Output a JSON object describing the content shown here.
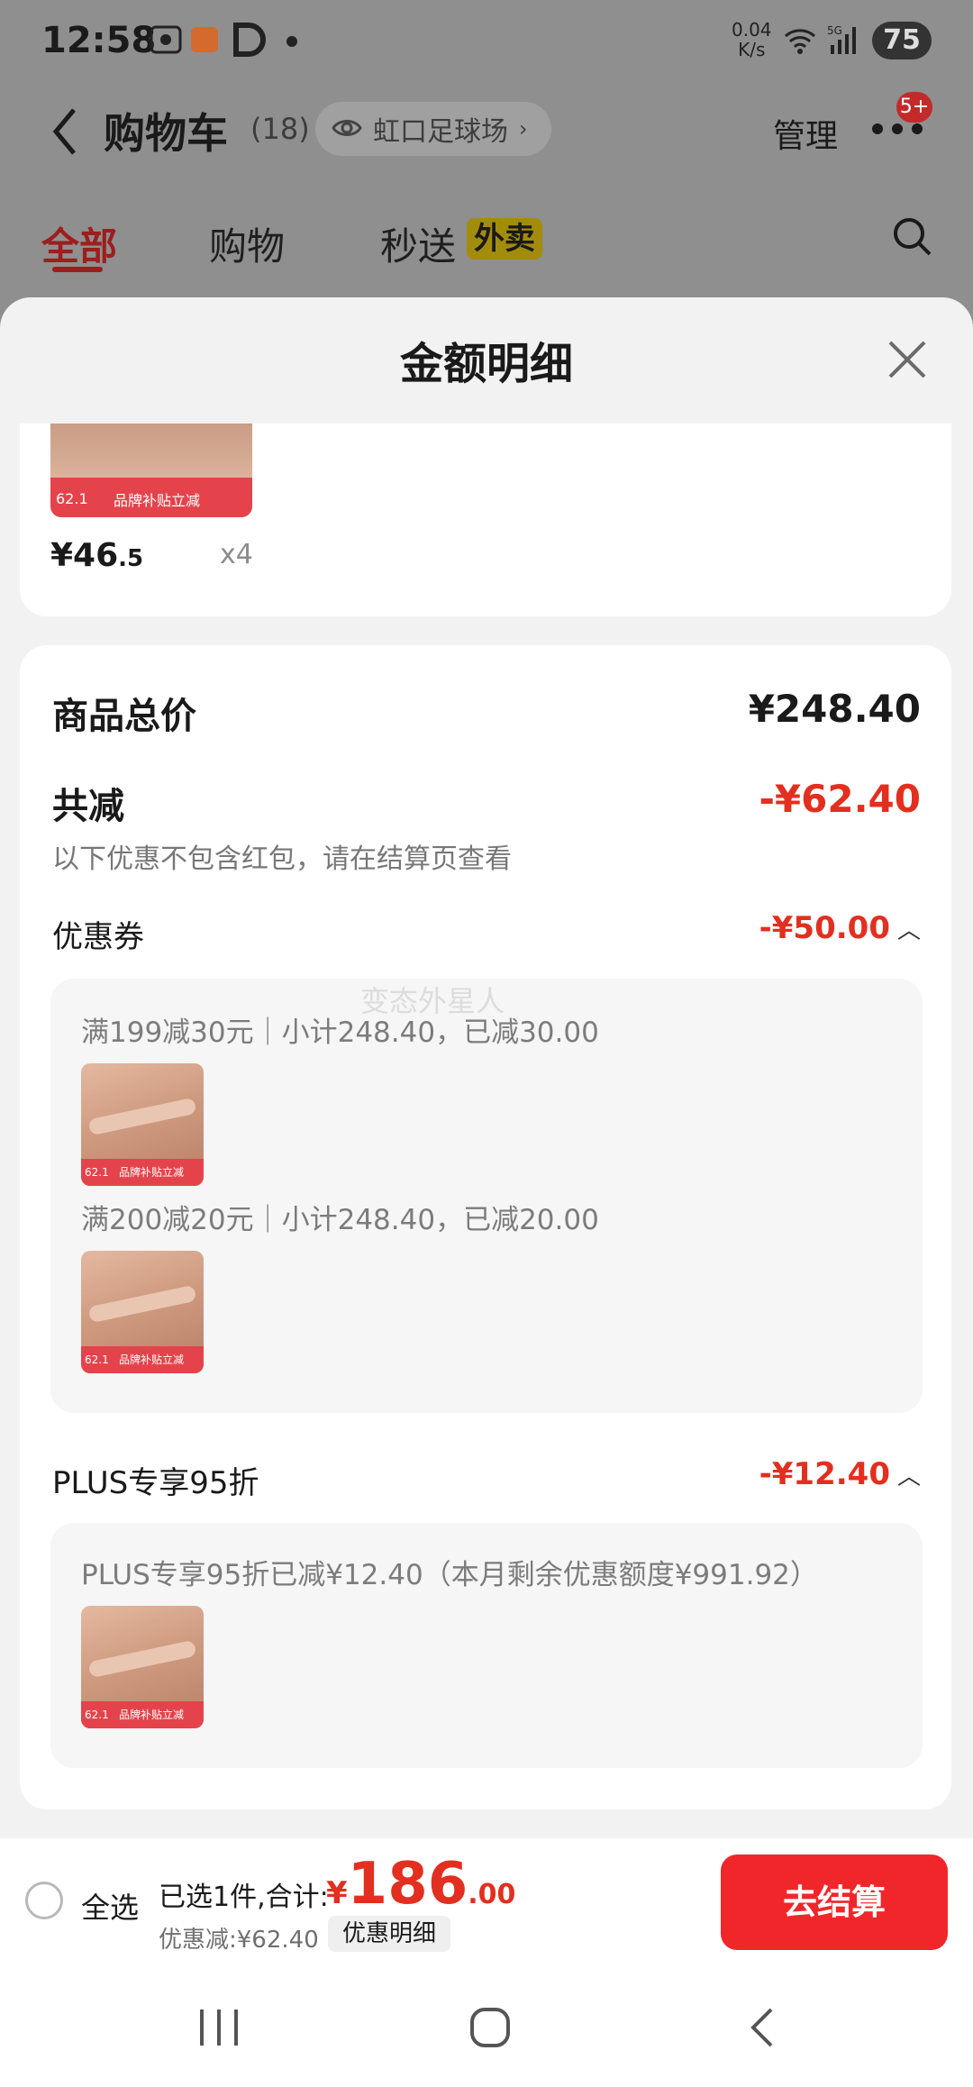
{
  "status": {
    "time": "12:58",
    "net_speed": "0.04\nK/s",
    "network": "5G",
    "battery": "75"
  },
  "header": {
    "title": "购物车",
    "count": "(18)",
    "location": "虹口足球场",
    "manage": "管理",
    "badge": "5+"
  },
  "tabs": [
    {
      "label": "全部"
    },
    {
      "label": "购物"
    },
    {
      "label": "秒送"
    },
    {
      "label": "外卖"
    }
  ],
  "sheet": {
    "title": "金额明细",
    "item": {
      "price_int": "¥46",
      "price_dec": ".5",
      "qty": "x4"
    },
    "summary": {
      "total_label": "商品总价",
      "total_value": "¥248.40",
      "reduce_label": "共减",
      "reduce_value": "-¥62.40",
      "reduce_note": "以下优惠不包含红包，请在结算页查看"
    },
    "coupon": {
      "label": "优惠券",
      "value": "-¥50.00",
      "rules": [
        "满199减30元｜小计248.40，已减30.00",
        "满200减20元｜小计248.40，已减20.00"
      ]
    },
    "watermark": "变态外星人",
    "plus": {
      "label": "PLUS专享95折",
      "value": "-¥12.40",
      "rule": "PLUS专享95折已减¥12.40（本月剩余优惠额度¥991.92）"
    },
    "thumb_text": {
      "left": "62.1",
      "band": "品牌补贴立减"
    }
  },
  "bottom": {
    "select_all": "全选",
    "selected_text": "已选1件,合计:",
    "total_yen": "¥",
    "total_int": "186",
    "total_dec": ".00",
    "discount_text": "优惠减:¥62.40",
    "detail_button": "优惠明细",
    "checkout": "去结算"
  }
}
